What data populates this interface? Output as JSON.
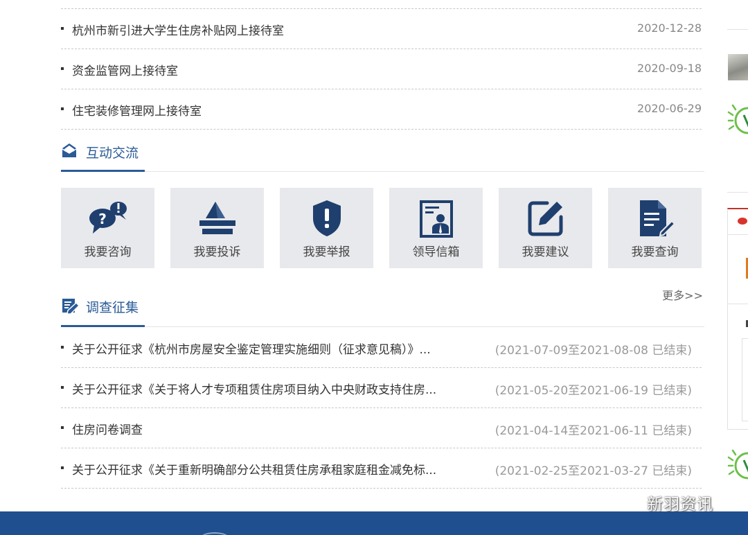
{
  "reception_list": [
    {
      "title": "杭州市新引进大学生住房补贴网上接待室",
      "date": "2020-12-28"
    },
    {
      "title": "资金监管网上接待室",
      "date": "2020-09-18"
    },
    {
      "title": "住宅装修管理网上接待室",
      "date": "2020-06-29"
    }
  ],
  "interaction": {
    "title": "互动交流",
    "tiles": [
      {
        "label": "我要咨询",
        "icon": "consult-icon"
      },
      {
        "label": "我要投诉",
        "icon": "complaint-icon"
      },
      {
        "label": "我要举报",
        "icon": "report-icon"
      },
      {
        "label": "领导信箱",
        "icon": "leader-mailbox-icon"
      },
      {
        "label": "我要建议",
        "icon": "suggestion-icon"
      },
      {
        "label": "我要查询",
        "icon": "query-icon"
      }
    ]
  },
  "survey": {
    "title": "调查征集",
    "more": "更多>>",
    "items": [
      {
        "title": "关于公开征求《杭州市房屋安全鉴定管理实施细则（征求意见稿）》...",
        "period": "(2021-07-09至2021-08-08 已结束)"
      },
      {
        "title": "关于公开征求《关于将人才专项租赁住房项目纳入中央财政支持住房...",
        "period": "(2021-05-20至2021-06-19 已结束)"
      },
      {
        "title": "住房问卷调查",
        "period": "(2021-04-14至2021-06-11 已结束)"
      },
      {
        "title": "关于公开征求《关于重新明确部分公共租赁住房承租家庭租金减免标...",
        "period": "(2021-02-25至2021-03-27 已结束)"
      }
    ]
  },
  "watermark": {
    "text": "新羽资讯"
  },
  "colors": {
    "accent": "#2a5b96",
    "icon": "#1f3f6e",
    "tile_bg": "#e8e9ec",
    "footer": "#1f4f8f"
  }
}
